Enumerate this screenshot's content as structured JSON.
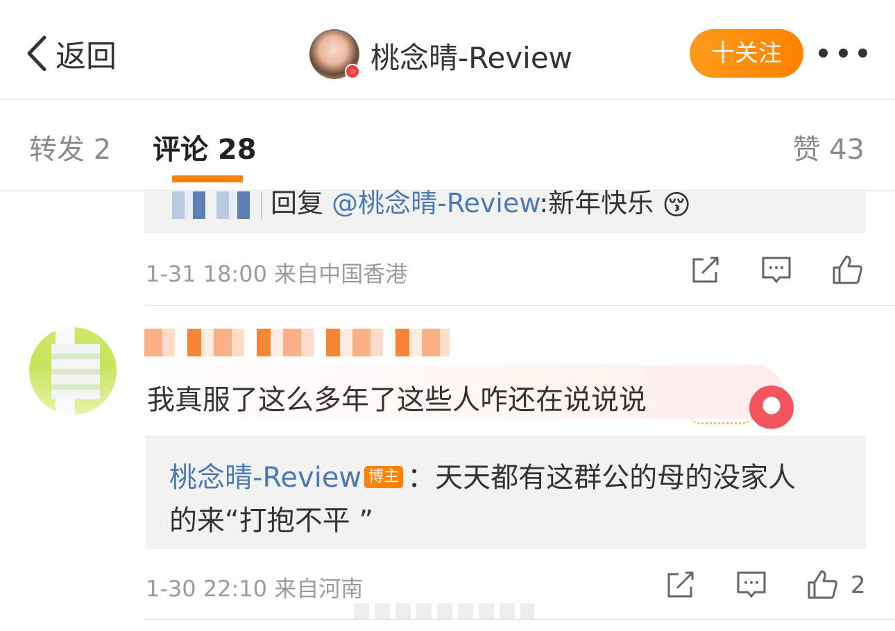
{
  "nav": {
    "back_label": "返回",
    "author_name": "桃念晴-Review",
    "follow_label": "十关注"
  },
  "tabs": {
    "repost": "转发 2",
    "comments": "评论 28",
    "likes": "赞 43"
  },
  "thread1": {
    "reply_text_prefix": "回复",
    "reply_mention": "@桃念晴-Review",
    "reply_text": ":新年快乐",
    "reply_emoji": "😚",
    "timestamp": "1-31 18:00",
    "location": "来自中国香港"
  },
  "thread2": {
    "comment_text": "我真服了这么多年了这些人咋还在说说说",
    "reply_author": "桃念晴-Review",
    "author_badge": "博主",
    "reply_line1": "：天天都有这群公的母的没家人",
    "reply_line2": "的来“打抱不平 ”",
    "timestamp": "1-30 22:10",
    "location": "来自河南",
    "like_count": "2"
  },
  "colors": {
    "accent": "#ff8200",
    "link": "#4b79b6",
    "meta_text": "#9b9b9b"
  }
}
